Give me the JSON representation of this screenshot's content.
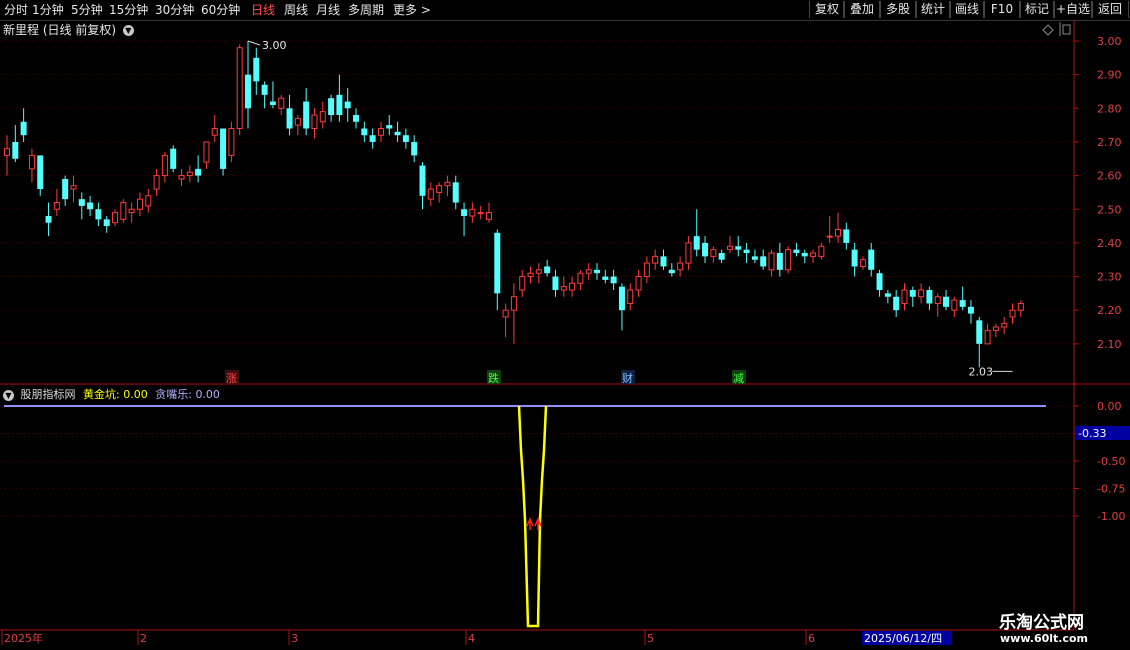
{
  "toolbar": {
    "periods": [
      "分时",
      "1分钟",
      "5分钟",
      "15分钟",
      "30分钟",
      "60分钟",
      "日线",
      "周线",
      "月线",
      "多周期",
      "更多"
    ],
    "active_period": "日线",
    "right_buttons": [
      "复权",
      "叠加",
      "多股",
      "统计",
      "画线",
      "F10",
      "标记",
      "+自选",
      "返回"
    ]
  },
  "stock": {
    "name": "新里程",
    "mode": "(日线 前复权)"
  },
  "indicator": {
    "name": "股朋指标网",
    "items": [
      {
        "label": "黄金坑:",
        "value": "0.00",
        "color": "#ffff00"
      },
      {
        "label": "贪嘴乐:",
        "value": "0.00",
        "color": "#b0b0ff"
      }
    ]
  },
  "colors": {
    "up": "#ff3c3c",
    "down": "#54ffff",
    "axis": "#b01010",
    "grid": "#3c0000",
    "indicator_line": "#ffff00",
    "flat_line": "#9090ff"
  },
  "chart_data": [
    {
      "type": "candlestick",
      "title": "新里程",
      "y_ticks": [
        "3.00",
        "2.90",
        "2.80",
        "2.70",
        "2.60",
        "2.50",
        "2.40",
        "2.30",
        "2.20",
        "2.10"
      ],
      "ylim": [
        2.0,
        3.05
      ],
      "annotations": [
        {
          "text": "3.00",
          "kind": "high"
        },
        {
          "text": "2.03",
          "kind": "low"
        }
      ],
      "event_markers": [
        {
          "text": "涨",
          "color": "#ff4040",
          "box": "#401010"
        },
        {
          "text": "跌",
          "color": "#40ff40",
          "box": "#104010"
        },
        {
          "text": "财",
          "color": "#80c0ff",
          "box": "#102040"
        },
        {
          "text": "减",
          "color": "#40ff40",
          "box": "#104010"
        }
      ],
      "candles": [
        [
          2.66,
          2.72,
          2.6,
          2.68
        ],
        [
          2.7,
          2.75,
          2.64,
          2.65
        ],
        [
          2.76,
          2.8,
          2.7,
          2.72
        ],
        [
          2.62,
          2.68,
          2.58,
          2.66
        ],
        [
          2.66,
          2.66,
          2.54,
          2.56
        ],
        [
          2.48,
          2.52,
          2.42,
          2.46
        ],
        [
          2.5,
          2.56,
          2.48,
          2.52
        ],
        [
          2.59,
          2.6,
          2.51,
          2.53
        ],
        [
          2.56,
          2.6,
          2.52,
          2.57
        ],
        [
          2.53,
          2.55,
          2.47,
          2.51
        ],
        [
          2.52,
          2.54,
          2.48,
          2.5
        ],
        [
          2.5,
          2.52,
          2.45,
          2.47
        ],
        [
          2.47,
          2.48,
          2.43,
          2.45
        ],
        [
          2.46,
          2.5,
          2.45,
          2.49
        ],
        [
          2.47,
          2.53,
          2.46,
          2.52
        ],
        [
          2.49,
          2.52,
          2.46,
          2.5
        ],
        [
          2.5,
          2.55,
          2.48,
          2.53
        ],
        [
          2.51,
          2.56,
          2.49,
          2.54
        ],
        [
          2.56,
          2.62,
          2.54,
          2.6
        ],
        [
          2.6,
          2.67,
          2.58,
          2.66
        ],
        [
          2.68,
          2.69,
          2.61,
          2.62
        ],
        [
          2.59,
          2.62,
          2.57,
          2.6
        ],
        [
          2.6,
          2.63,
          2.58,
          2.61
        ],
        [
          2.62,
          2.66,
          2.58,
          2.6
        ],
        [
          2.64,
          2.7,
          2.62,
          2.7
        ],
        [
          2.72,
          2.78,
          2.7,
          2.74
        ],
        [
          2.74,
          2.74,
          2.6,
          2.62
        ],
        [
          2.66,
          2.76,
          2.64,
          2.74
        ],
        [
          2.74,
          2.99,
          2.72,
          2.98
        ],
        [
          2.9,
          3.0,
          2.74,
          2.8
        ],
        [
          2.95,
          2.98,
          2.84,
          2.88
        ],
        [
          2.87,
          2.88,
          2.8,
          2.84
        ],
        [
          2.82,
          2.88,
          2.8,
          2.81
        ],
        [
          2.8,
          2.84,
          2.78,
          2.83
        ],
        [
          2.8,
          2.84,
          2.72,
          2.74
        ],
        [
          2.75,
          2.78,
          2.72,
          2.77
        ],
        [
          2.82,
          2.86,
          2.72,
          2.74
        ],
        [
          2.74,
          2.8,
          2.71,
          2.78
        ],
        [
          2.76,
          2.82,
          2.74,
          2.79
        ],
        [
          2.83,
          2.84,
          2.76,
          2.78
        ],
        [
          2.84,
          2.9,
          2.76,
          2.78
        ],
        [
          2.82,
          2.86,
          2.76,
          2.8
        ],
        [
          2.78,
          2.8,
          2.74,
          2.76
        ],
        [
          2.74,
          2.76,
          2.7,
          2.72
        ],
        [
          2.72,
          2.74,
          2.68,
          2.7
        ],
        [
          2.72,
          2.76,
          2.7,
          2.74
        ],
        [
          2.75,
          2.78,
          2.72,
          2.74
        ],
        [
          2.73,
          2.76,
          2.7,
          2.72
        ],
        [
          2.72,
          2.74,
          2.68,
          2.7
        ],
        [
          2.7,
          2.72,
          2.64,
          2.66
        ],
        [
          2.63,
          2.64,
          2.5,
          2.54
        ],
        [
          2.53,
          2.58,
          2.51,
          2.56
        ],
        [
          2.55,
          2.58,
          2.52,
          2.57
        ],
        [
          2.57,
          2.6,
          2.54,
          2.58
        ],
        [
          2.58,
          2.6,
          2.5,
          2.52
        ],
        [
          2.5,
          2.52,
          2.42,
          2.48
        ],
        [
          2.48,
          2.52,
          2.46,
          2.5
        ],
        [
          2.49,
          2.51,
          2.47,
          2.49
        ],
        [
          2.47,
          2.52,
          2.46,
          2.49
        ],
        [
          2.43,
          2.44,
          2.2,
          2.25
        ],
        [
          2.18,
          2.22,
          2.12,
          2.2
        ],
        [
          2.2,
          2.28,
          2.1,
          2.24
        ],
        [
          2.26,
          2.32,
          2.24,
          2.3
        ],
        [
          2.3,
          2.33,
          2.28,
          2.31
        ],
        [
          2.31,
          2.34,
          2.28,
          2.32
        ],
        [
          2.33,
          2.35,
          2.3,
          2.31
        ],
        [
          2.3,
          2.32,
          2.24,
          2.26
        ],
        [
          2.26,
          2.3,
          2.24,
          2.27
        ],
        [
          2.26,
          2.3,
          2.24,
          2.28
        ],
        [
          2.28,
          2.32,
          2.26,
          2.31
        ],
        [
          2.31,
          2.34,
          2.29,
          2.32
        ],
        [
          2.32,
          2.34,
          2.29,
          2.31
        ],
        [
          2.3,
          2.32,
          2.28,
          2.29
        ],
        [
          2.3,
          2.32,
          2.26,
          2.28
        ],
        [
          2.27,
          2.28,
          2.14,
          2.2
        ],
        [
          2.22,
          2.28,
          2.2,
          2.26
        ],
        [
          2.26,
          2.32,
          2.24,
          2.3
        ],
        [
          2.3,
          2.36,
          2.28,
          2.34
        ],
        [
          2.34,
          2.38,
          2.32,
          2.36
        ],
        [
          2.36,
          2.38,
          2.32,
          2.33
        ],
        [
          2.32,
          2.34,
          2.3,
          2.31
        ],
        [
          2.32,
          2.36,
          2.3,
          2.34
        ],
        [
          2.34,
          2.42,
          2.32,
          2.4
        ],
        [
          2.42,
          2.5,
          2.36,
          2.38
        ],
        [
          2.4,
          2.42,
          2.34,
          2.36
        ],
        [
          2.36,
          2.39,
          2.34,
          2.38
        ],
        [
          2.37,
          2.38,
          2.34,
          2.35
        ],
        [
          2.38,
          2.42,
          2.37,
          2.39
        ],
        [
          2.39,
          2.42,
          2.36,
          2.38
        ],
        [
          2.38,
          2.4,
          2.34,
          2.37
        ],
        [
          2.36,
          2.38,
          2.34,
          2.35
        ],
        [
          2.36,
          2.38,
          2.32,
          2.33
        ],
        [
          2.32,
          2.38,
          2.3,
          2.37
        ],
        [
          2.37,
          2.4,
          2.3,
          2.32
        ],
        [
          2.32,
          2.39,
          2.31,
          2.38
        ],
        [
          2.38,
          2.4,
          2.36,
          2.37
        ],
        [
          2.37,
          2.38,
          2.34,
          2.36
        ],
        [
          2.36,
          2.38,
          2.34,
          2.37
        ],
        [
          2.36,
          2.4,
          2.35,
          2.39
        ],
        [
          2.42,
          2.48,
          2.4,
          2.42
        ],
        [
          2.42,
          2.49,
          2.4,
          2.44
        ],
        [
          2.44,
          2.46,
          2.38,
          2.4
        ],
        [
          2.38,
          2.4,
          2.3,
          2.33
        ],
        [
          2.33,
          2.36,
          2.32,
          2.35
        ],
        [
          2.38,
          2.4,
          2.3,
          2.32
        ],
        [
          2.31,
          2.32,
          2.24,
          2.26
        ],
        [
          2.25,
          2.26,
          2.22,
          2.24
        ],
        [
          2.24,
          2.26,
          2.18,
          2.2
        ],
        [
          2.22,
          2.28,
          2.2,
          2.26
        ],
        [
          2.26,
          2.27,
          2.21,
          2.24
        ],
        [
          2.24,
          2.28,
          2.22,
          2.26
        ],
        [
          2.26,
          2.27,
          2.2,
          2.22
        ],
        [
          2.22,
          2.25,
          2.18,
          2.24
        ],
        [
          2.24,
          2.26,
          2.2,
          2.21
        ],
        [
          2.2,
          2.24,
          2.18,
          2.23
        ],
        [
          2.23,
          2.27,
          2.2,
          2.21
        ],
        [
          2.21,
          2.23,
          2.16,
          2.19
        ],
        [
          2.17,
          2.18,
          2.03,
          2.1
        ],
        [
          2.1,
          2.16,
          2.1,
          2.14
        ],
        [
          2.14,
          2.16,
          2.12,
          2.15
        ],
        [
          2.15,
          2.18,
          2.13,
          2.16
        ],
        [
          2.18,
          2.22,
          2.16,
          2.2
        ],
        [
          2.2,
          2.23,
          2.18,
          2.22
        ]
      ]
    },
    {
      "type": "line",
      "title": "股朋指标网",
      "y_ticks": [
        "0.00",
        "-0.25",
        "-0.50",
        "-0.75",
        "-1.00"
      ],
      "ylim": [
        -1.9,
        0.0
      ],
      "current_value_label": "-0.33",
      "series": [
        {
          "name": "黄金坑",
          "x": [
            0,
            1,
            2,
            3,
            4,
            5,
            6,
            7,
            8,
            9,
            10
          ],
          "values": [
            0,
            0,
            -0.6,
            -1.0,
            -1.9,
            -1.9,
            -1.0,
            -0.6,
            0,
            0,
            0
          ]
        }
      ]
    }
  ],
  "time_axis": {
    "labels": [
      "2025年",
      "2",
      "3",
      "4",
      "5",
      "6"
    ],
    "cursor_date": "2025/06/12/四"
  },
  "watermark": {
    "logo": "乐淘公式网",
    "site": "www.60lt.com"
  }
}
